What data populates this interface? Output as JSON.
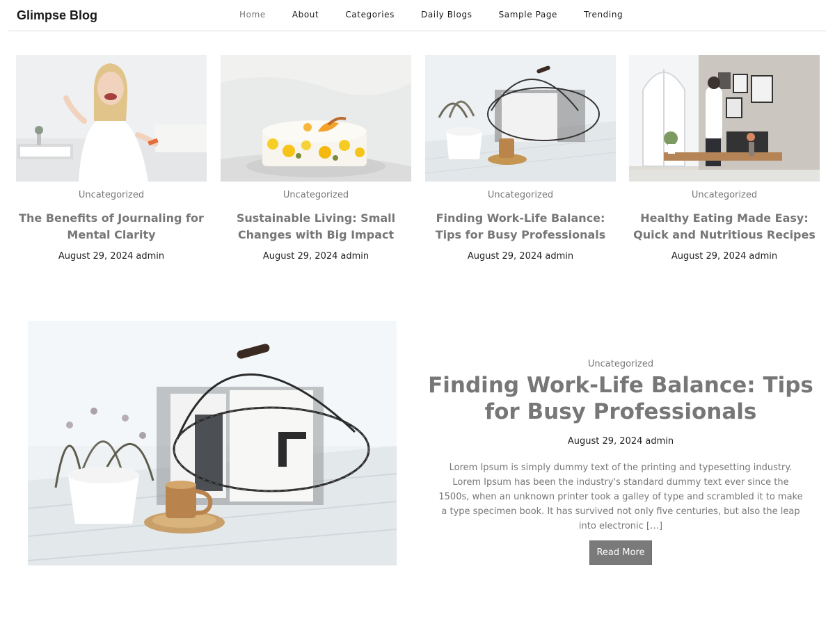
{
  "site": {
    "title": "Glimpse Blog"
  },
  "nav": {
    "items": [
      {
        "label": "Home",
        "active": true
      },
      {
        "label": "About"
      },
      {
        "label": "Categories"
      },
      {
        "label": "Daily Blogs"
      },
      {
        "label": "Sample Page"
      },
      {
        "label": "Trending"
      }
    ]
  },
  "posts": [
    {
      "category": "Uncategorized",
      "title": "The Benefits of Journaling for Mental Clarity",
      "date": "August 29, 2024",
      "author": "admin",
      "image": "woman-photo"
    },
    {
      "category": "Uncategorized",
      "title": "Sustainable Living: Small Changes with Big Impact",
      "date": "August 29, 2024",
      "author": "admin",
      "image": "cake-photo"
    },
    {
      "category": "Uncategorized",
      "title": "Finding Work-Life Balance: Tips for Busy Professionals",
      "date": "August 29, 2024",
      "author": "admin",
      "image": "basket-photo"
    },
    {
      "category": "Uncategorized",
      "title": "Healthy Eating Made Easy: Quick and Nutritious Recipes",
      "date": "August 29, 2024",
      "author": "admin",
      "image": "room-photo"
    }
  ],
  "featured": {
    "category": "Uncategorized",
    "title": "Finding Work-Life Balance: Tips for Busy Professionals",
    "date": "August 29, 2024",
    "author": "admin",
    "excerpt": "Lorem Ipsum is simply dummy text of the printing and typesetting industry. Lorem Ipsum has been the industry's standard dummy text ever since the 1500s, when an unknown printer took a galley of type and scrambled it to make a type specimen book. It has survived not only five centuries, but also the leap into electronic […]",
    "button_label": "Read More",
    "image": "basket-photo"
  },
  "colors": {
    "muted": "#777777",
    "button_bg": "#7a7a7a",
    "divider": "#dcdcdc"
  }
}
